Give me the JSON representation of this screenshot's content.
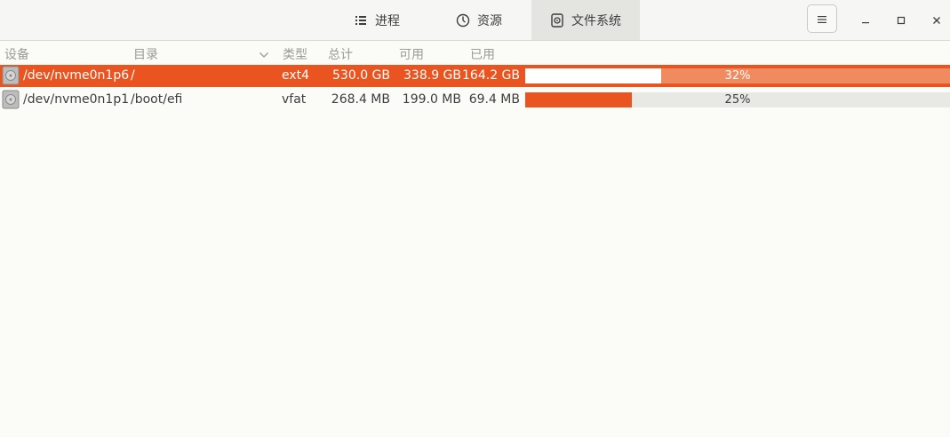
{
  "header": {
    "tabs": [
      {
        "label": "进程",
        "icon": "list-icon",
        "active": false
      },
      {
        "label": "资源",
        "icon": "gauge-icon",
        "active": false
      },
      {
        "label": "文件系统",
        "icon": "disk-icon",
        "active": true
      }
    ],
    "menu_icon": "hamburger-menu-icon",
    "window_controls": [
      "minimize-icon",
      "maximize-icon",
      "close-icon"
    ]
  },
  "columns": {
    "device": "设备",
    "directory": "目录",
    "type": "类型",
    "total": "总计",
    "available": "可用",
    "used": "已用"
  },
  "rows": [
    {
      "device": "/dev/nvme0n1p6",
      "directory": "/",
      "type": "ext4",
      "total": "530.0 GB",
      "available": "338.9 GB",
      "used": "164.2 GB",
      "percent_label": "32%",
      "percent_value": 32,
      "selected": true
    },
    {
      "device": "/dev/nvme0n1p1",
      "directory": "/boot/efi",
      "type": "vfat",
      "total": "268.4 MB",
      "available": "199.0 MB",
      "used": "69.4 MB",
      "percent_label": "25%",
      "percent_value": 25,
      "selected": false
    }
  ],
  "colors": {
    "accent": "#e95420",
    "accent_light": "#f08a61"
  }
}
